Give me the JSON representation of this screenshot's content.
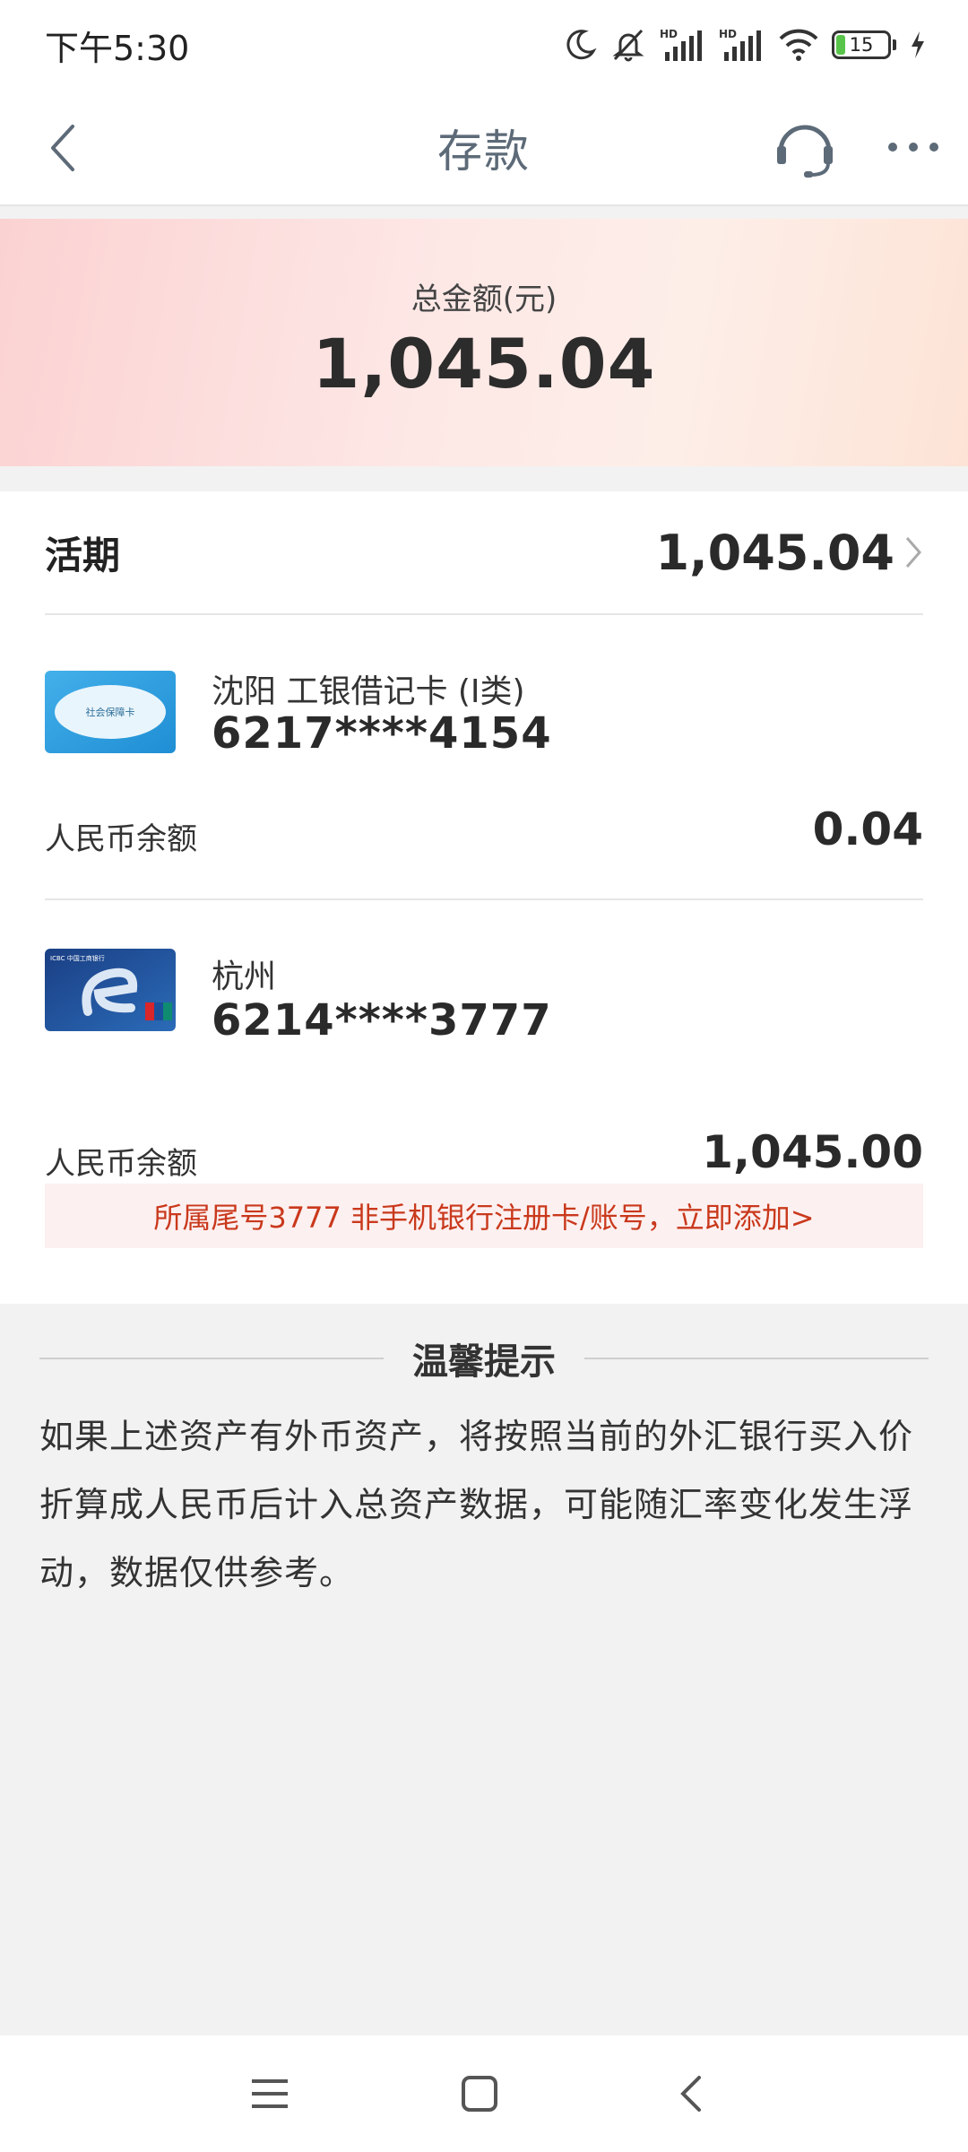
{
  "status_bar": {
    "time": "下午5:30",
    "battery_level": "15",
    "icons": [
      "moon-icon",
      "mute-icon",
      "hd-signal-icon",
      "hd-signal-icon",
      "wifi-icon",
      "battery-icon",
      "charging-icon"
    ]
  },
  "nav": {
    "title": "存款",
    "icons": [
      "back-icon",
      "headset-icon",
      "more-icon"
    ]
  },
  "summary": {
    "total_label": "总金额(元)",
    "total_amount": "1,045.04"
  },
  "demand": {
    "label": "活期",
    "amount": "1,045.04"
  },
  "accounts": [
    {
      "branch": "沈阳 工银借记卡 (I类)",
      "number": "6217****4154",
      "balance_label": "人民币余额",
      "balance": "0.04",
      "card_text": "社会保障卡"
    },
    {
      "branch": "杭州",
      "number": "6214****3777",
      "balance_label": "人民币余额",
      "balance": "1,045.00",
      "card_text": "ICBC 中国工商银行",
      "notice": "所属尾号3777 非手机银行注册卡/账号，立即添加>"
    }
  ],
  "tips": {
    "title": "温馨提示",
    "body": "如果上述资产有外币资产，将按照当前的外汇银行买入价折算成人民币后计入总资产数据，可能随汇率变化发生浮动，数据仅供参考。"
  },
  "colors": {
    "accent_red": "#c9391c",
    "title_gray": "#5d6a78",
    "battery_green": "#58c54a"
  }
}
